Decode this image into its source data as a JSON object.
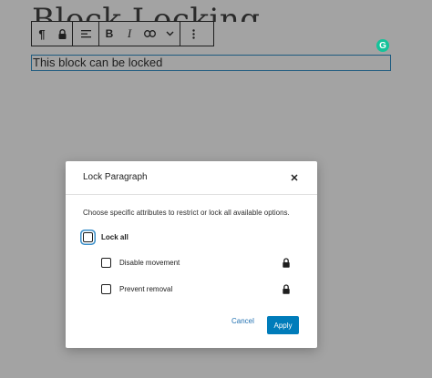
{
  "editor": {
    "post_title": "Block Locking",
    "block_text": "This block can be locked"
  },
  "toolbar": {
    "paragraph_icon": "pilcrow-icon",
    "buttons": [
      "pilcrow-icon",
      "lock-icon",
      "align-icon",
      "bold-icon",
      "italic-icon",
      "link-icon",
      "chevron-down-icon",
      "more-options-icon"
    ]
  },
  "grammarly": {
    "letter": "G",
    "color": "#15c39a"
  },
  "modal": {
    "title": "Lock Paragraph",
    "description": "Choose specific attributes to restrict or lock all available options.",
    "lock_all_label": "Lock all",
    "options": [
      {
        "label": "Disable movement",
        "checked": false
      },
      {
        "label": "Prevent removal",
        "checked": false
      }
    ],
    "cancel_label": "Cancel",
    "apply_label": "Apply",
    "accent_color": "#007cba"
  }
}
